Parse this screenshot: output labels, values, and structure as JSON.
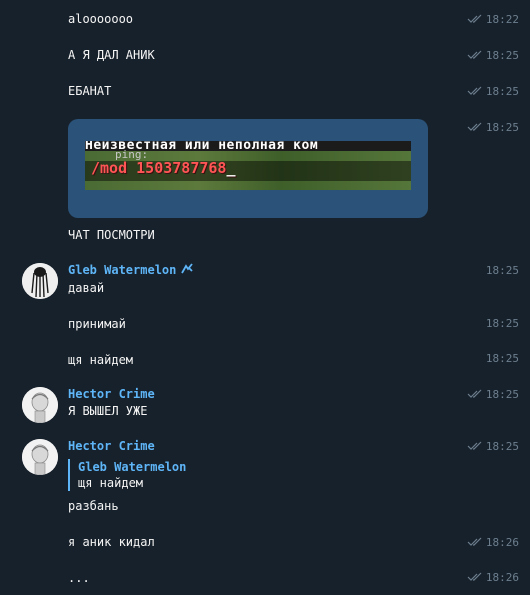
{
  "messages": [
    {
      "text": "alooooooo",
      "time": "18:22",
      "read": true
    },
    {
      "text": "А Я ДАЛ АНИК",
      "time": "18:25",
      "read": true
    },
    {
      "text": "ЕБАНАТ",
      "time": "18:25",
      "read": true
    },
    {
      "text": "ЧАТ ПОСМОТРИ",
      "time": "",
      "read": false
    }
  ],
  "photo": {
    "time": "18:25",
    "line1": "Неизвестная или неполная ком",
    "ping": "ping:",
    "cmd": "/mod 1503787768",
    "cursor": "_"
  },
  "gleb": {
    "name": "Gleb Watermelon",
    "msgs": [
      {
        "text": "давай",
        "time": "18:25"
      },
      {
        "text": "принимай",
        "time": "18:25"
      },
      {
        "text": "щя найдем",
        "time": "18:25"
      }
    ]
  },
  "hector1": {
    "name": "Hector Crime",
    "text": "Я ВЫШЕЛ УЖЕ",
    "time": "18:25"
  },
  "hector2": {
    "name": "Hector Crime",
    "time": "18:25",
    "reply_name": "Gleb Watermelon",
    "reply_text": "щя найдем"
  },
  "tail": [
    {
      "text": "разбань",
      "time": ""
    },
    {
      "text": "я аник кидал",
      "time": "18:26"
    },
    {
      "text": "...",
      "time": "18:26"
    }
  ],
  "colors": {
    "background": "#17212b",
    "name": "#5eb5f7",
    "meta": "#6d7f8f",
    "photo_card": "#2b5278"
  },
  "icons": {
    "read": "double-check-icon",
    "verified": "verified-icon"
  }
}
